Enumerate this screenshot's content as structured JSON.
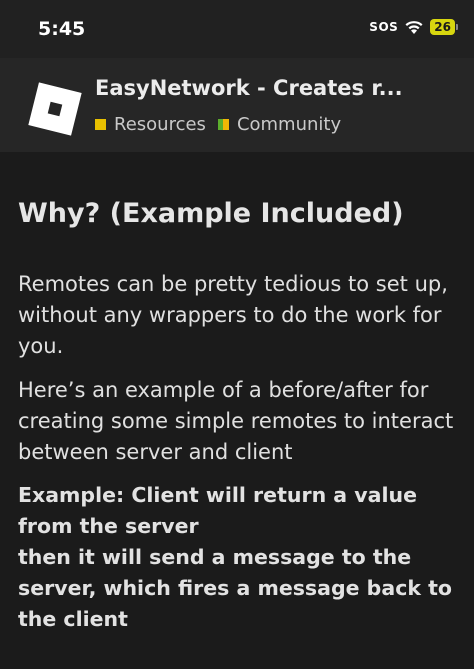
{
  "status_bar": {
    "time": "5:45",
    "sos": "SOS",
    "battery": "26"
  },
  "topic": {
    "title": "EasyNetwork - Creates r...",
    "categories": [
      {
        "label": "Resources",
        "color": "#e8c000"
      },
      {
        "label": "Community",
        "colors": [
          "#5cae2d",
          "#f2b705"
        ]
      }
    ]
  },
  "post": {
    "heading": "Why? (Example Included)",
    "paragraph_1": "Remotes can be pretty tedious to set up, without any wrappers to do the work for you.",
    "paragraph_2": "Here’s an example of a before/after for creating some simple remotes to interact between server and client",
    "example_line_1": "Example: Client will return a value from the server",
    "example_line_2": "then it will send a message to the server, which fires a message back to the client"
  }
}
